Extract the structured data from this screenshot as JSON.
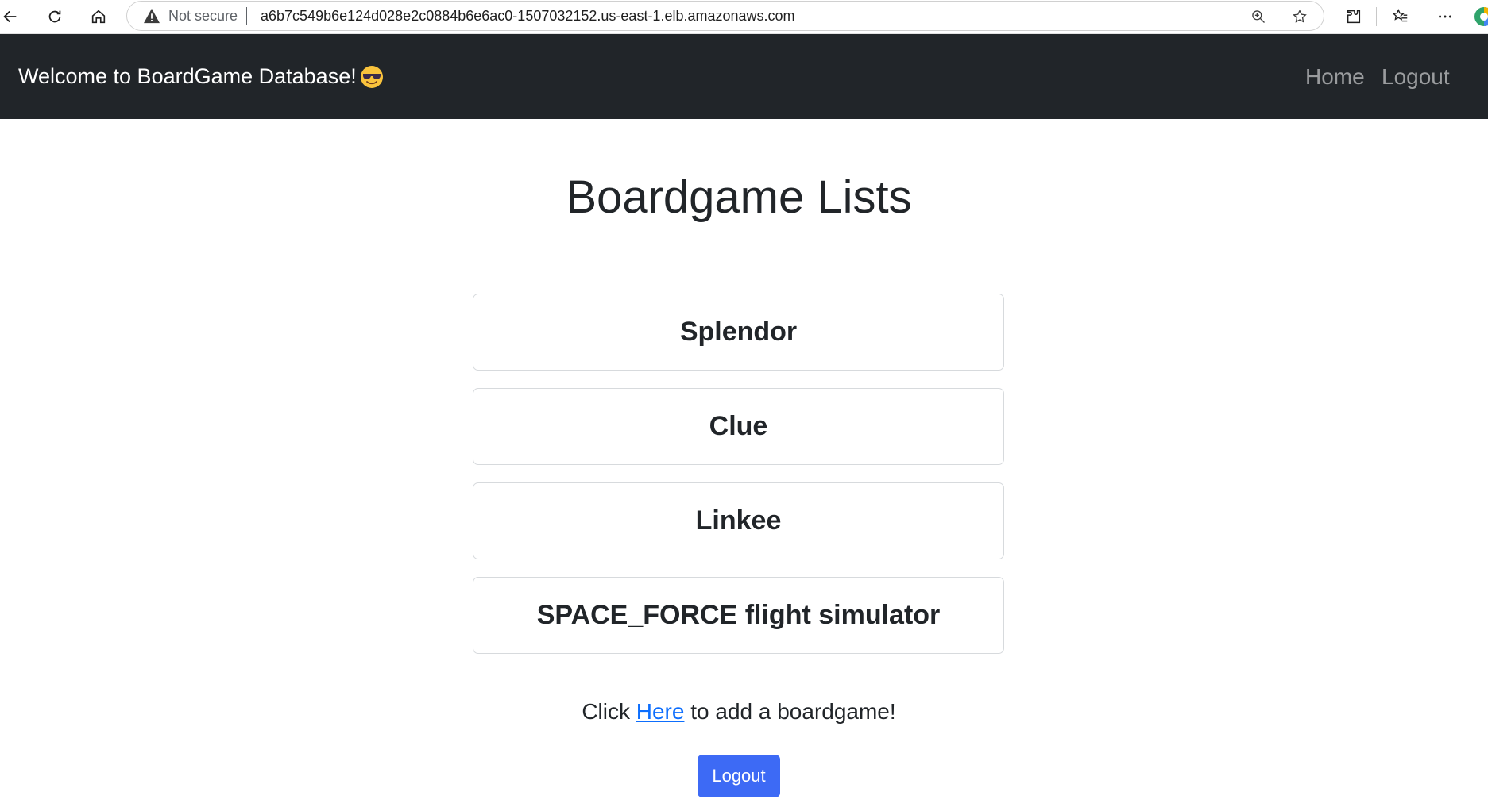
{
  "browser": {
    "security_label": "Not secure",
    "url": "a6b7c549b6e124d028e2c0884b6e6ac0-1507032152.us-east-1.elb.amazonaws.com",
    "icons": [
      "back-arrow-icon",
      "refresh-icon",
      "home-icon",
      "warning-icon",
      "zoom-icon",
      "star-icon",
      "extensions-icon",
      "favorites-icon",
      "more-icon",
      "edge-logo-icon"
    ]
  },
  "navbar": {
    "brand": "Welcome to BoardGame Database!",
    "brand_emoji": "sunglasses-face-emoji",
    "links": {
      "home": "Home",
      "logout": "Logout"
    }
  },
  "main": {
    "title": "Boardgame Lists",
    "games": [
      "Splendor",
      "Clue",
      "Linkee",
      "SPACE_FORCE flight simulator"
    ],
    "add_prefix": "Click ",
    "add_link": "Here",
    "add_suffix": " to add a boardgame!",
    "logout_button": "Logout"
  },
  "colors": {
    "navbar_bg": "#212529",
    "primary_button": "#3d6af5",
    "link": "#0d6efd"
  }
}
